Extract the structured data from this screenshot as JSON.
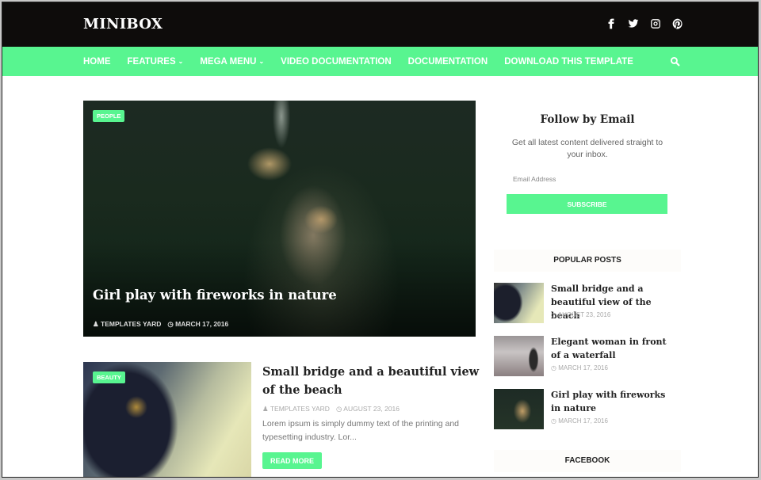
{
  "header": {
    "logo": "MINIBOX",
    "social": [
      {
        "name": "facebook-icon"
      },
      {
        "name": "twitter-icon"
      },
      {
        "name": "instagram-icon"
      },
      {
        "name": "pinterest-icon"
      }
    ]
  },
  "nav": {
    "items": [
      {
        "label": "HOME",
        "dropdown": false
      },
      {
        "label": "FEATURES",
        "dropdown": true
      },
      {
        "label": "MEGA MENU",
        "dropdown": true
      },
      {
        "label": "VIDEO DOCUMENTATION",
        "dropdown": false
      },
      {
        "label": "DOCUMENTATION",
        "dropdown": false
      },
      {
        "label": "DOWNLOAD THIS TEMPLATE",
        "dropdown": false
      }
    ],
    "chevron": "⌄"
  },
  "hero": {
    "tag": "PEOPLE",
    "title": "Girl play with fireworks in nature",
    "author": "TEMPLATES YARD",
    "date": "MARCH 17, 2016"
  },
  "post2": {
    "tag": "BEAUTY",
    "title": "Small bridge and a beautiful view of the beach",
    "author": "TEMPLATES YARD",
    "date": "AUGUST 23, 2016",
    "excerpt": "Lorem ipsum is simply dummy text of the printing and typesetting industry. Lor...",
    "read_more": "READ MORE"
  },
  "sidebar": {
    "follow": {
      "title": "Follow by Email",
      "description": "Get all latest content delivered straight to your inbox.",
      "email_placeholder": "Email Address",
      "subscribe": "SUBSCRIBE"
    },
    "popular_heading": "POPULAR POSTS",
    "popular_posts": [
      {
        "title": "Small bridge and a beautiful view of the beach",
        "date": "AUGUST 23, 2016"
      },
      {
        "title": "Elegant woman in front of a waterfall",
        "date": "MARCH 17, 2016"
      },
      {
        "title": "Girl play with fireworks in nature",
        "date": "MARCH 17, 2016"
      }
    ],
    "facebook_heading": "FACEBOOK"
  },
  "colors": {
    "accent": "#58f590",
    "topbar": "#0e0c0b"
  }
}
